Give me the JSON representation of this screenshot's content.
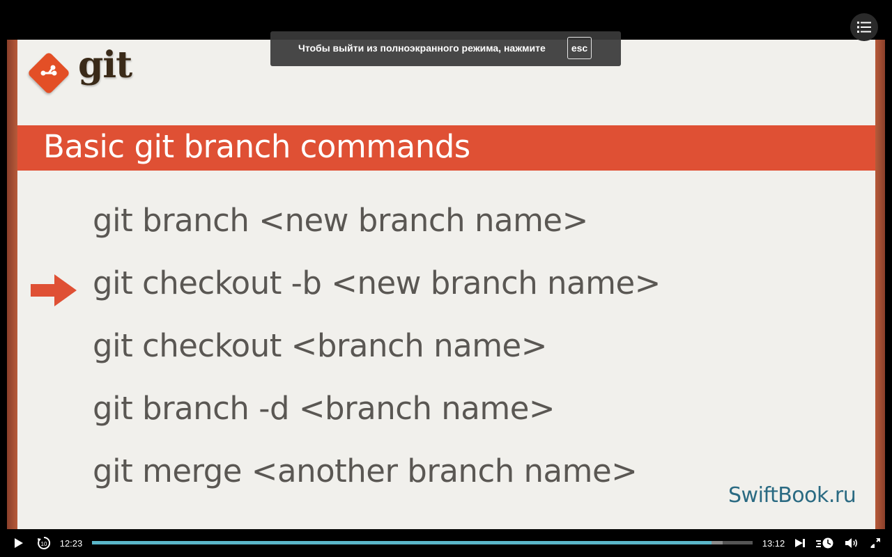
{
  "slide": {
    "logo_text": "git",
    "title": "Basic git branch commands",
    "commands": [
      "git branch <new branch name>",
      "git checkout -b <new branch name>",
      "git checkout <branch name>",
      "git branch -d <branch name>",
      "git merge <another branch name>"
    ],
    "highlighted_command_index": 1,
    "brand": "SwiftBook.ru"
  },
  "fullscreen_toast": {
    "message": "Чтобы выйти из полноэкранного режима, нажмите",
    "key": "esc"
  },
  "player": {
    "current_time": "12:23",
    "duration": "13:12",
    "progress_fraction": 0.938,
    "buffered_fraction": 0.955,
    "icons": {
      "play": "play-icon",
      "rewind": "rewind-10-icon",
      "next": "next-track-icon",
      "speed": "playback-speed-icon",
      "volume": "volume-icon",
      "exit_fullscreen": "exit-fullscreen-icon",
      "menu": "list-menu-icon"
    }
  },
  "colors": {
    "accent_orange": "#df5034",
    "progress": "#59b6c9",
    "brand_blue": "#2a6a82"
  }
}
